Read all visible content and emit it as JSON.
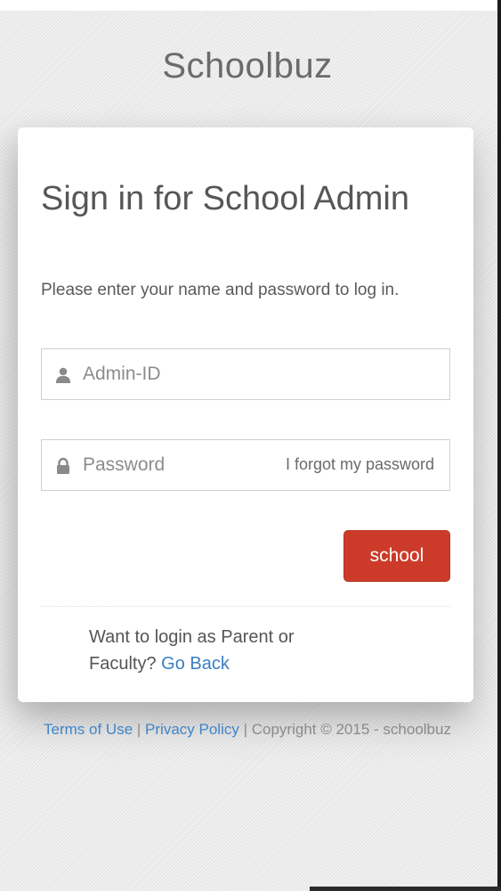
{
  "brand": {
    "title": "Schoolbuz"
  },
  "card": {
    "title": "Sign in for School Admin",
    "description": "Please enter your name and password to log in."
  },
  "form": {
    "admin_id": {
      "placeholder": "Admin-ID",
      "value": "",
      "icon": "user-icon"
    },
    "password": {
      "placeholder": "Password",
      "value": "",
      "icon": "lock-icon",
      "forgot_label": "I forgot my password"
    },
    "submit_label": "school"
  },
  "alt_login": {
    "text": "Want to login as Parent or Faculty?",
    "link_label": "Go Back"
  },
  "footer": {
    "terms_label": "Terms of Use",
    "separator": "|",
    "privacy_label": "Privacy Policy",
    "copyright": "Copyright © 2015 - schoolbuz"
  },
  "colors": {
    "accent_button": "#cc3b2a",
    "link": "#3a7fc4",
    "brand_text": "#6b6b6b"
  }
}
